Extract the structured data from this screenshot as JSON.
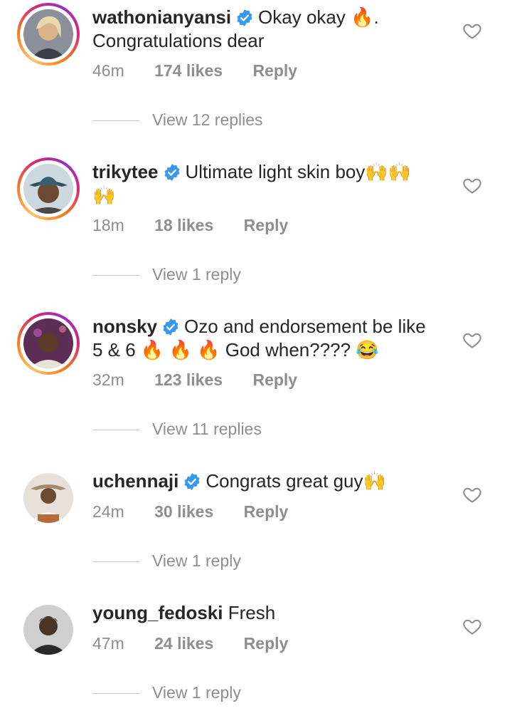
{
  "comments": [
    {
      "username": "wathonianyansi",
      "text_line1": "Okay okay 🔥.",
      "text_line2": "Congratulations dear",
      "time": "46m",
      "likes": "174 likes",
      "reply_label": "Reply",
      "view_replies": "View 12 replies",
      "avatar_color": "#6a6f7a"
    },
    {
      "username": "trikytee",
      "text_line1": "Ultimate light skin boy🙌🙌",
      "text_line2": "🙌",
      "time": "18m",
      "likes": "18 likes",
      "reply_label": "Reply",
      "view_replies": "View 1 reply",
      "avatar_color": "#3b5f6e"
    },
    {
      "username": "nonsky",
      "text_line1": "Ozo and endorsement be like",
      "text_line2": "5 & 6 🔥 🔥 🔥 God when???? 😂",
      "time": "32m",
      "likes": "123 likes",
      "reply_label": "Reply",
      "view_replies": "View 11 replies",
      "avatar_color": "#7a3f6b"
    },
    {
      "username": "uchennaji",
      "text_line1": "Congrats great guy🙌",
      "text_line2": "",
      "time": "24m",
      "likes": "30 likes",
      "reply_label": "Reply",
      "view_replies": "View 1 reply",
      "avatar_color": "#cfc6bd"
    },
    {
      "username": "young_fedoski",
      "text_line1": "Fresh",
      "text_line2": "",
      "time": "47m",
      "likes": "24 likes",
      "reply_label": "Reply",
      "view_replies": "View 1 reply",
      "avatar_color": "#5a5a5a"
    }
  ],
  "colors": {
    "verified_blue": "#3897f0",
    "meta_gray": "#8e8e8e",
    "text": "#262626"
  }
}
